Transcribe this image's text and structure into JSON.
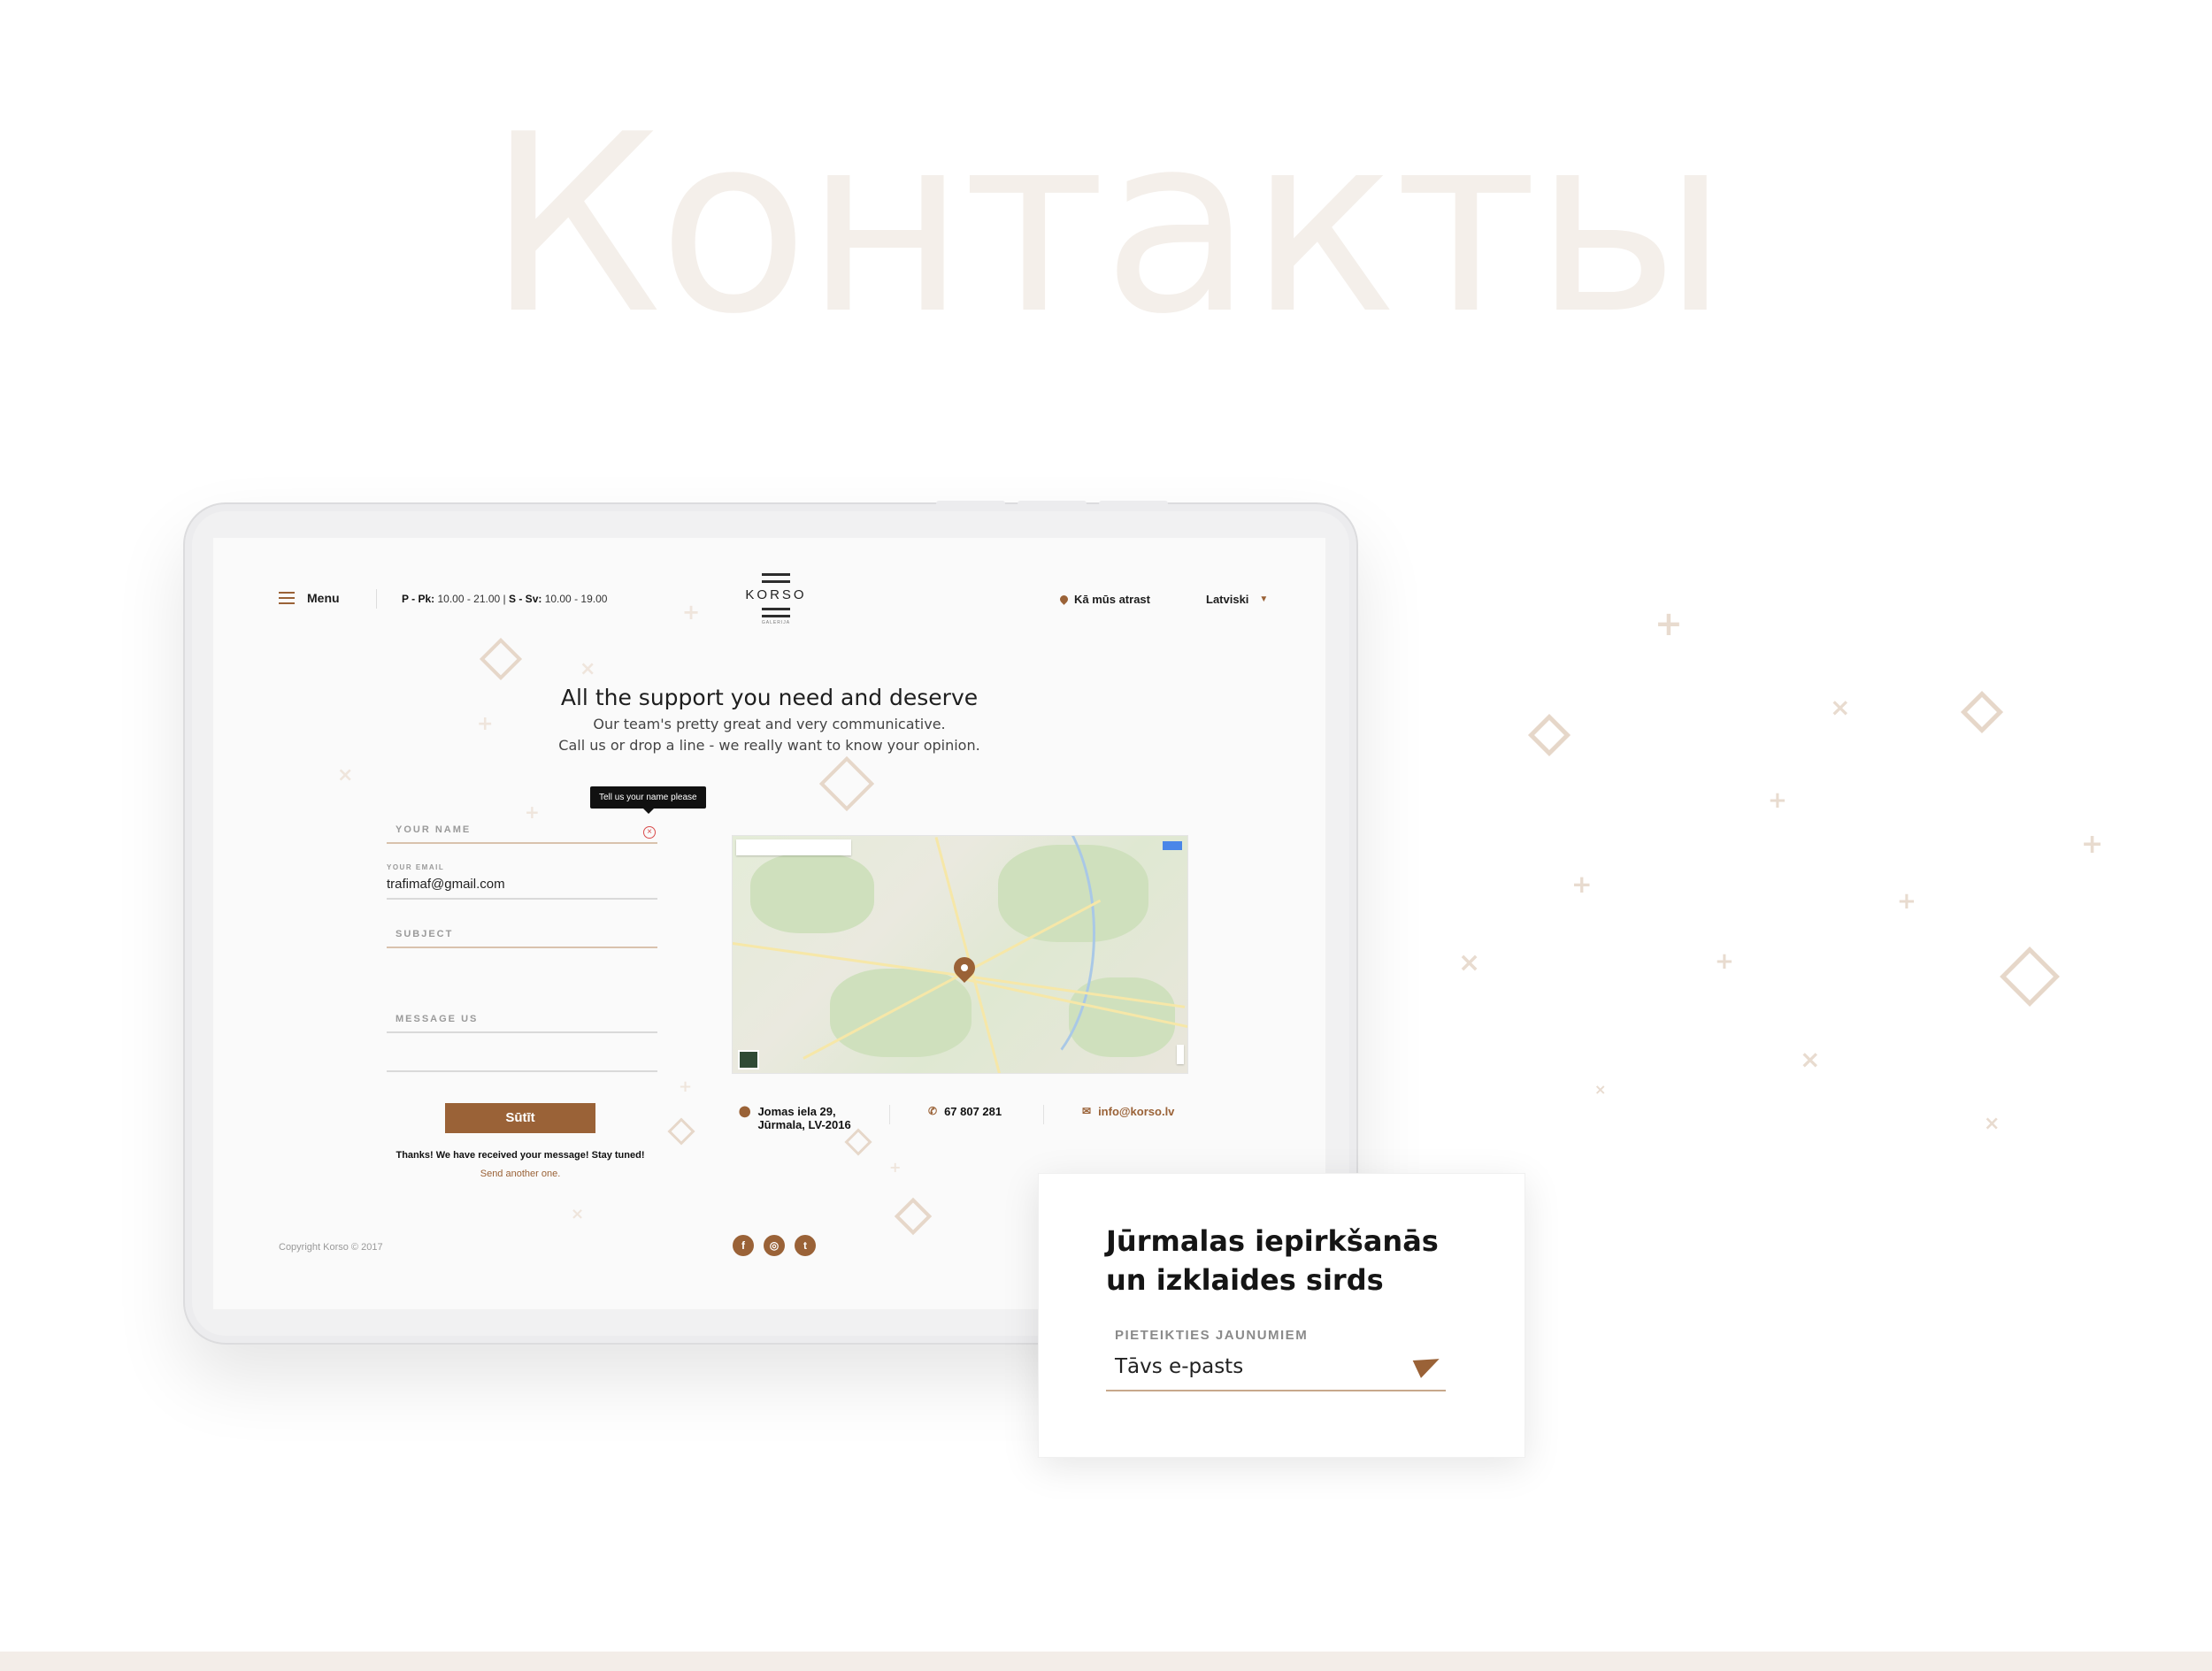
{
  "hero_title": "Контакты",
  "site": {
    "nav": {
      "menu_label": "Menu",
      "hours_weekdays_label": "P - Pk:",
      "hours_weekdays_value": "10.00 - 21.00",
      "hours_separator": "|",
      "hours_weekend_label": "S - Sv:",
      "hours_weekend_value": "10.00 - 19.00",
      "find_us": "Kā mūs atrast",
      "language": "Latviski"
    },
    "logo": {
      "name": "KORSO",
      "tagline": "GALERIJA"
    },
    "contact": {
      "heading": "All the support you need and deserve",
      "subtitle_line1": "Our team's pretty great and very communicative.",
      "subtitle_line2": "Call us or drop a line - we really want to know your opinion."
    },
    "form": {
      "tooltip": "Tell us your name please",
      "name_placeholder": "YOUR NAME",
      "email_label": "YOUR EMAIL",
      "email_value": "trafimaf@gmail.com",
      "subject_placeholder": "SUBJECT",
      "message_placeholder": "MESSAGE US",
      "submit_label": "Sūtīt",
      "success_message": "Thanks! We have received your message! Stay tuned!",
      "send_another": "Send another one."
    },
    "address": {
      "line1": "Jomas iela 29,",
      "line2": "Jūrmala, LV-2016"
    },
    "phone": "67 807 281",
    "email": "info@korso.lv",
    "copyright": "Copyright Korso © 2017",
    "social": [
      {
        "name": "facebook-icon",
        "glyph": "f"
      },
      {
        "name": "instagram-icon",
        "glyph": "◎"
      },
      {
        "name": "twitter-icon",
        "glyph": "t"
      }
    ]
  },
  "newsletter": {
    "title": "Jūrmalas iepirkšanās un izklaides sirds",
    "label": "PIETEIKTIES JAUNUMIEM",
    "input_placeholder": "Tāvs e-pasts"
  },
  "colors": {
    "accent": "#9a6237",
    "hero_text": "#f4efea",
    "decor": "#e6d7c9"
  }
}
